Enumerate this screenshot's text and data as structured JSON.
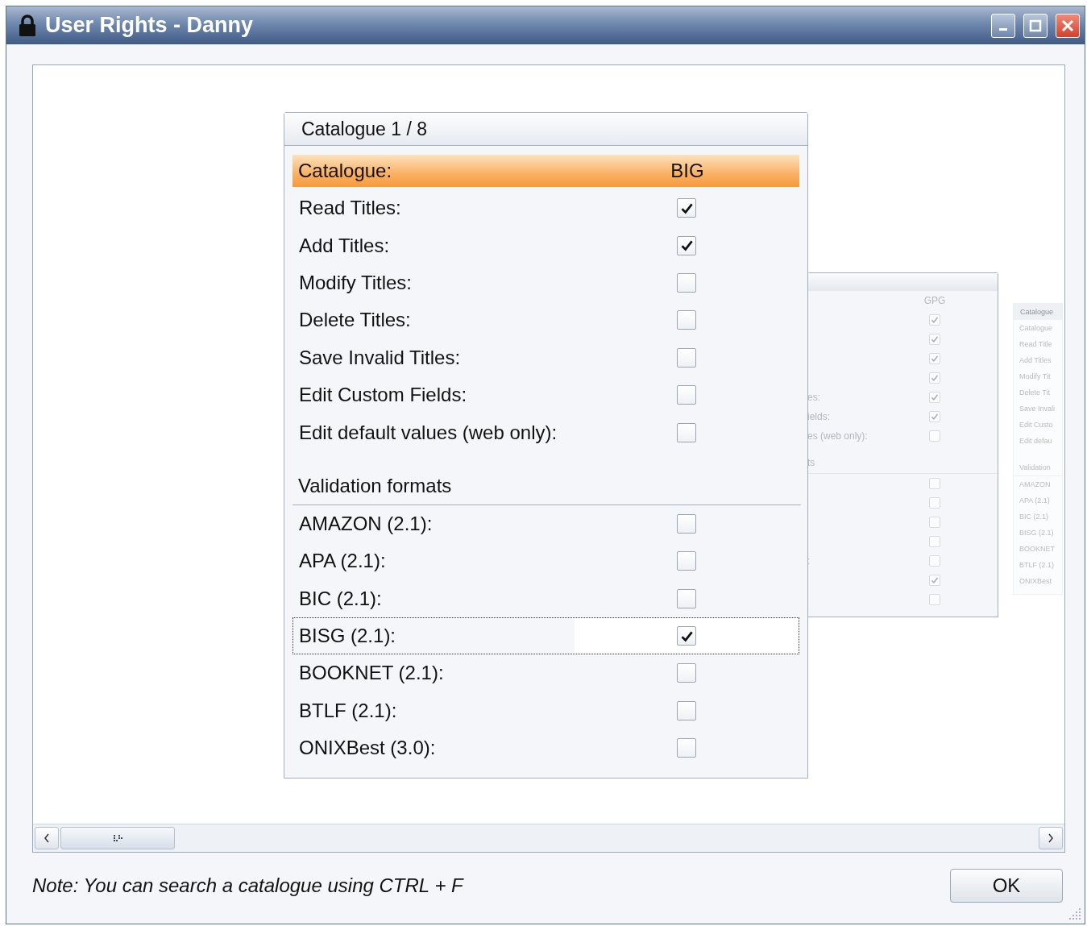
{
  "window": {
    "title": "User Rights - Danny"
  },
  "carousel": {
    "main": {
      "title": "Catalogue 1 / 8",
      "header": {
        "label": "Catalogue:",
        "value": "BIG"
      },
      "rights": [
        {
          "label": "Read Titles:",
          "checked": true
        },
        {
          "label": "Add Titles:",
          "checked": true
        },
        {
          "label": "Modify Titles:",
          "checked": false
        },
        {
          "label": "Delete Titles:",
          "checked": false
        },
        {
          "label": "Save Invalid Titles:",
          "checked": false
        },
        {
          "label": "Edit Custom Fields:",
          "checked": false
        },
        {
          "label": "Edit default values (web only):",
          "checked": false
        }
      ],
      "section": "Validation formats",
      "formats": [
        {
          "label": "AMAZON (2.1):",
          "checked": false,
          "focused": false
        },
        {
          "label": "APA (2.1):",
          "checked": false,
          "focused": false
        },
        {
          "label": "BIC (2.1):",
          "checked": false,
          "focused": false
        },
        {
          "label": "BISG (2.1):",
          "checked": true,
          "focused": true
        },
        {
          "label": "BOOKNET (2.1):",
          "checked": false,
          "focused": false
        },
        {
          "label": "BTLF (2.1):",
          "checked": false,
          "focused": false
        },
        {
          "label": "ONIXBest (3.0):",
          "checked": false,
          "focused": false
        }
      ]
    },
    "second": {
      "column": "GPG",
      "rights": [
        {
          "checked": true
        },
        {
          "checked": true
        },
        {
          "checked": true
        },
        {
          "checked": true
        },
        {
          "label": "es:",
          "checked": true
        },
        {
          "label": "ields:",
          "checked": true
        },
        {
          "label": "es (web only):",
          "checked": false
        }
      ],
      "section": "ts",
      "formats": [
        {
          "checked": false
        },
        {
          "checked": false
        },
        {
          "checked": false
        },
        {
          "checked": false
        },
        {
          "label": ":",
          "checked": false
        },
        {
          "checked": true
        },
        {
          "checked": false
        }
      ]
    },
    "third": {
      "title": "Catalogue",
      "rights": [
        "Catalogue",
        "Read Title",
        "Add Titles",
        "Modify Tit",
        "Delete Tit",
        "Save Invali",
        "Edit Custo",
        "Edit defau"
      ],
      "section": "Validation",
      "formats": [
        "AMAZON",
        "APA (2.1)",
        "BIC (2.1)",
        "BISG (2.1)",
        "BOOKNET",
        "BTLF (2.1)",
        "ONIXBest"
      ]
    }
  },
  "note": "Note: You can search a catalogue using CTRL + F",
  "ok": "OK"
}
